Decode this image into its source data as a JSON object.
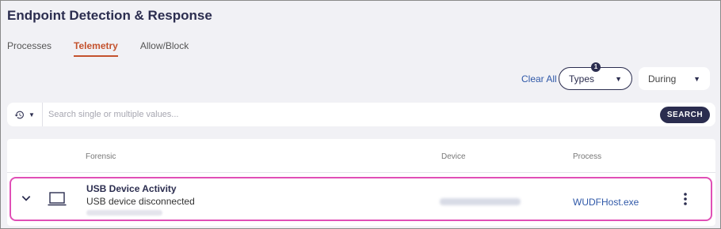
{
  "page": {
    "title": "Endpoint Detection & Response"
  },
  "tabs": [
    {
      "label": "Processes",
      "active": false
    },
    {
      "label": "Telemetry",
      "active": true
    },
    {
      "label": "Allow/Block",
      "active": false
    }
  ],
  "filters": {
    "clear_all": "Clear All",
    "types": {
      "label": "Types",
      "badge": "1"
    },
    "during": {
      "label": "During"
    }
  },
  "search": {
    "placeholder": "Search single or multiple values...",
    "button": "SEARCH",
    "history_icon": "history-icon"
  },
  "table": {
    "columns": [
      "Forensic",
      "Device",
      "Process"
    ],
    "rows": [
      {
        "forensic_title": "USB Device Activity",
        "forensic_subtitle": "USB device disconnected",
        "process": "WUDFHost.exe",
        "icon": "laptop-icon",
        "selected": true
      }
    ]
  },
  "colors": {
    "accent": "#c4522d",
    "primary": "#2b2d4f",
    "link": "#2f58a8",
    "highlight": "#e04fb6"
  }
}
